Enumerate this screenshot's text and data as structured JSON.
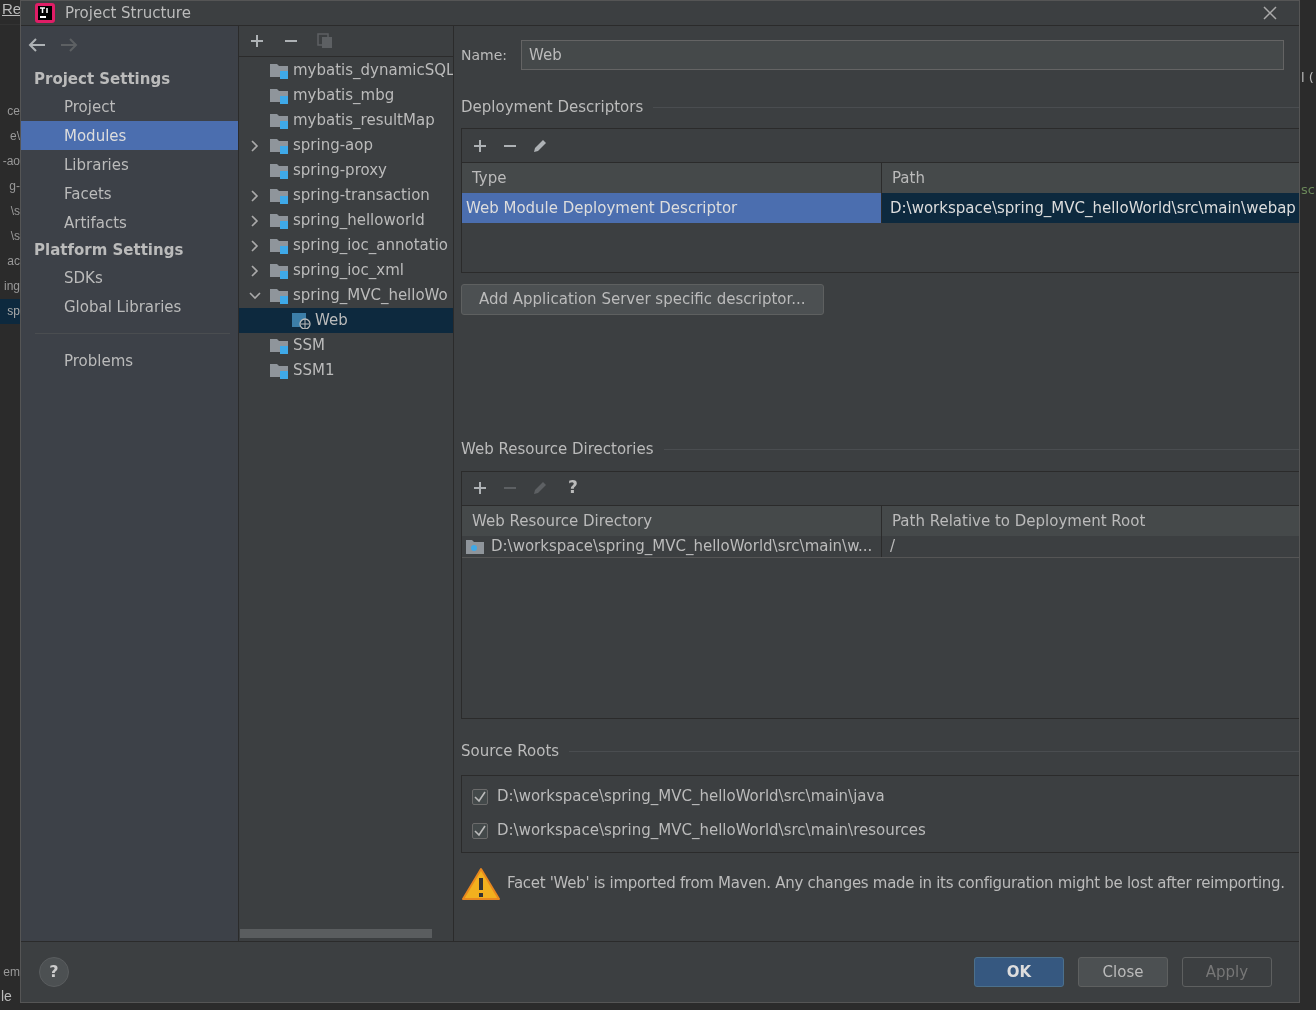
{
  "background": {
    "title_fragment": "Re",
    "lines": [
      {
        "text": "ce",
        "selected": false
      },
      {
        "text": "e\\",
        "selected": false
      },
      {
        "text": "-ao",
        "selected": false
      },
      {
        "text": "g-",
        "selected": false
      },
      {
        "text": "\\s",
        "selected": false
      },
      {
        "text": "\\s",
        "selected": false
      },
      {
        "text": "ac",
        "selected": false
      },
      {
        "text": "ing",
        "selected": false
      },
      {
        "text": "sp",
        "selected": true
      }
    ],
    "bottom_tab": "em",
    "status_line": "le",
    "right_fragments": [
      "l (",
      "sc"
    ]
  },
  "window": {
    "title": "Project Structure"
  },
  "nav": {
    "back_enabled": true,
    "forward_enabled": false,
    "sections": [
      {
        "heading": "Project Settings",
        "items": [
          {
            "label": "Project",
            "selected": false
          },
          {
            "label": "Modules",
            "selected": true
          },
          {
            "label": "Libraries",
            "selected": false
          },
          {
            "label": "Facets",
            "selected": false
          },
          {
            "label": "Artifacts",
            "selected": false
          }
        ]
      },
      {
        "heading": "Platform Settings",
        "items": [
          {
            "label": "SDKs",
            "selected": false
          },
          {
            "label": "Global Libraries",
            "selected": false
          }
        ]
      }
    ],
    "extra_items": [
      {
        "label": "Problems",
        "selected": false
      }
    ]
  },
  "tree": {
    "copy_enabled": false,
    "items": [
      {
        "label": "mybatis_dynamicSQL",
        "expandable": false,
        "selected": false
      },
      {
        "label": "mybatis_mbg",
        "expandable": false,
        "selected": false
      },
      {
        "label": "mybatis_resultMap",
        "expandable": false,
        "selected": false
      },
      {
        "label": "spring-aop",
        "expandable": true,
        "expanded": false,
        "selected": false
      },
      {
        "label": "spring-proxy",
        "expandable": false,
        "selected": false
      },
      {
        "label": "spring-transaction",
        "expandable": true,
        "expanded": false,
        "selected": false
      },
      {
        "label": "spring_helloworld",
        "expandable": true,
        "expanded": false,
        "selected": false
      },
      {
        "label": "spring_ioc_annotatio",
        "expandable": true,
        "expanded": false,
        "selected": false
      },
      {
        "label": "spring_ioc_xml",
        "expandable": true,
        "expanded": false,
        "selected": false
      },
      {
        "label": "spring_MVC_helloWo",
        "expandable": true,
        "expanded": true,
        "selected": false,
        "children": [
          {
            "label": "Web",
            "kind": "web",
            "selected": true
          }
        ]
      },
      {
        "label": "SSM",
        "expandable": false,
        "selected": false
      },
      {
        "label": "SSM1",
        "expandable": false,
        "selected": false
      }
    ]
  },
  "name_field": {
    "label": "Name:",
    "value": "Web"
  },
  "deployment_descriptors": {
    "title": "Deployment Descriptors",
    "edit_enabled": true,
    "remove_enabled": true,
    "columns": [
      "Type",
      "Path"
    ],
    "rows": [
      {
        "cells": [
          "Web Module Deployment Descriptor",
          "D:\\workspace\\spring_MVC_helloWorld\\src\\main\\webap"
        ],
        "selected": true
      }
    ],
    "button": "Add Application Server specific descriptor..."
  },
  "web_resource_directories": {
    "title": "Web Resource Directories",
    "edit_enabled": false,
    "remove_enabled": false,
    "help": "?",
    "columns": [
      "Web Resource Directory",
      "Path Relative to Deployment Root"
    ],
    "rows": [
      {
        "cells": [
          "D:\\workspace\\spring_MVC_helloWorld\\src\\main\\w...",
          "/"
        ],
        "selected": false
      }
    ]
  },
  "source_roots": {
    "title": "Source Roots",
    "items": [
      {
        "label": "D:\\workspace\\spring_MVC_helloWorld\\src\\main\\java",
        "checked": true
      },
      {
        "label": "D:\\workspace\\spring_MVC_helloWorld\\src\\main\\resources",
        "checked": true
      }
    ]
  },
  "warning": "Facet 'Web' is imported from Maven. Any changes made in its configuration might be lost after reimporting.",
  "buttons": [
    {
      "label": "OK",
      "kind": "default",
      "disabled": false
    },
    {
      "label": "Close",
      "kind": "normal",
      "disabled": false
    },
    {
      "label": "Apply",
      "kind": "normal",
      "disabled": true
    }
  ],
  "help_button": "?"
}
